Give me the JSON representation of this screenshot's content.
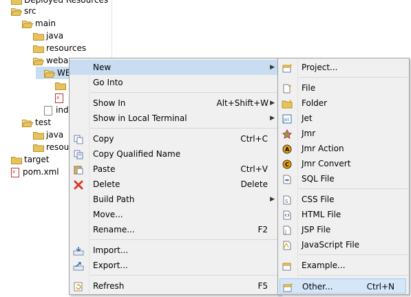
{
  "tree": {
    "items": [
      {
        "label": "Deployed Resources",
        "twisty": "",
        "icon": "folder"
      },
      {
        "label": "src",
        "twisty": "◢",
        "icon": "folder-open"
      },
      {
        "label": "main",
        "twisty": "◢",
        "icon": "folder-open"
      },
      {
        "label": "java",
        "twisty": "▷",
        "icon": "folder"
      },
      {
        "label": "resources",
        "twisty": "",
        "icon": "folder"
      },
      {
        "label": "webap",
        "twisty": "◢",
        "icon": "folder-open"
      },
      {
        "label": "WE",
        "twisty": "◢",
        "icon": "folder-open"
      },
      {
        "label": "",
        "twisty": "▷",
        "icon": "folder"
      },
      {
        "label": "",
        "twisty": "",
        "icon": "xml-file"
      },
      {
        "label": "ind",
        "twisty": "",
        "icon": "file"
      },
      {
        "label": "test",
        "twisty": "◢",
        "icon": "folder-open"
      },
      {
        "label": "java",
        "twisty": "",
        "icon": "folder"
      },
      {
        "label": "resour",
        "twisty": "",
        "icon": "folder"
      },
      {
        "label": "target",
        "twisty": "▷",
        "icon": "folder"
      },
      {
        "label": "pom.xml",
        "twisty": "",
        "icon": "xml-file"
      }
    ]
  },
  "context_menu": {
    "items": [
      {
        "label": "New",
        "accel": "",
        "submenu": true,
        "icon": ""
      },
      {
        "label": "Go Into",
        "accel": "",
        "submenu": false,
        "icon": ""
      },
      {
        "label": "Show In",
        "accel": "Alt+Shift+W",
        "submenu": true,
        "icon": ""
      },
      {
        "label": "Show in Local Terminal",
        "accel": "",
        "submenu": true,
        "icon": ""
      },
      {
        "label": "Copy",
        "accel": "Ctrl+C",
        "submenu": false,
        "icon": "copy-icon"
      },
      {
        "label": "Copy Qualified Name",
        "accel": "",
        "submenu": false,
        "icon": "copy-qualified-icon"
      },
      {
        "label": "Paste",
        "accel": "Ctrl+V",
        "submenu": false,
        "icon": "paste-icon"
      },
      {
        "label": "Delete",
        "accel": "Delete",
        "submenu": false,
        "icon": "delete-icon"
      },
      {
        "label": "Build Path",
        "accel": "",
        "submenu": true,
        "icon": ""
      },
      {
        "label": "Move...",
        "accel": "",
        "submenu": false,
        "icon": ""
      },
      {
        "label": "Rename...",
        "accel": "F2",
        "submenu": false,
        "icon": ""
      },
      {
        "label": "Import...",
        "accel": "",
        "submenu": false,
        "icon": "import-icon"
      },
      {
        "label": "Export...",
        "accel": "",
        "submenu": false,
        "icon": "export-icon"
      },
      {
        "label": "Refresh",
        "accel": "F5",
        "submenu": false,
        "icon": "refresh-icon"
      }
    ]
  },
  "new_submenu": {
    "items": [
      {
        "label": "Project...",
        "accel": "",
        "icon": "new-project-icon"
      },
      {
        "label": "File",
        "accel": "",
        "icon": "new-file-icon"
      },
      {
        "label": "Folder",
        "accel": "",
        "icon": "new-folder-icon"
      },
      {
        "label": "Jet",
        "accel": "",
        "icon": "jet-icon"
      },
      {
        "label": "Jmr",
        "accel": "",
        "icon": "jmr-icon"
      },
      {
        "label": "Jmr Action",
        "accel": "",
        "icon": "jmr-action-icon"
      },
      {
        "label": "Jmr Convert",
        "accel": "",
        "icon": "jmr-convert-icon"
      },
      {
        "label": "SQL File",
        "accel": "",
        "icon": "sql-file-icon"
      },
      {
        "label": "CSS File",
        "accel": "",
        "icon": "css-file-icon"
      },
      {
        "label": "HTML File",
        "accel": "",
        "icon": "html-file-icon"
      },
      {
        "label": "JSP File",
        "accel": "",
        "icon": "jsp-file-icon"
      },
      {
        "label": "JavaScript File",
        "accel": "",
        "icon": "javascript-file-icon"
      },
      {
        "label": "Example...",
        "accel": "",
        "icon": "example-icon"
      },
      {
        "label": "Other...",
        "accel": "Ctrl+N",
        "icon": "other-wizard-icon"
      }
    ]
  },
  "colors": {
    "menu_bg": "#f0f0f0",
    "highlight": "#c8dcf2",
    "folder": "#e8c25a",
    "delete_red": "#d83a2a",
    "jmr_orange": "#e8a000",
    "jet_blue": "#3a6fb5"
  }
}
